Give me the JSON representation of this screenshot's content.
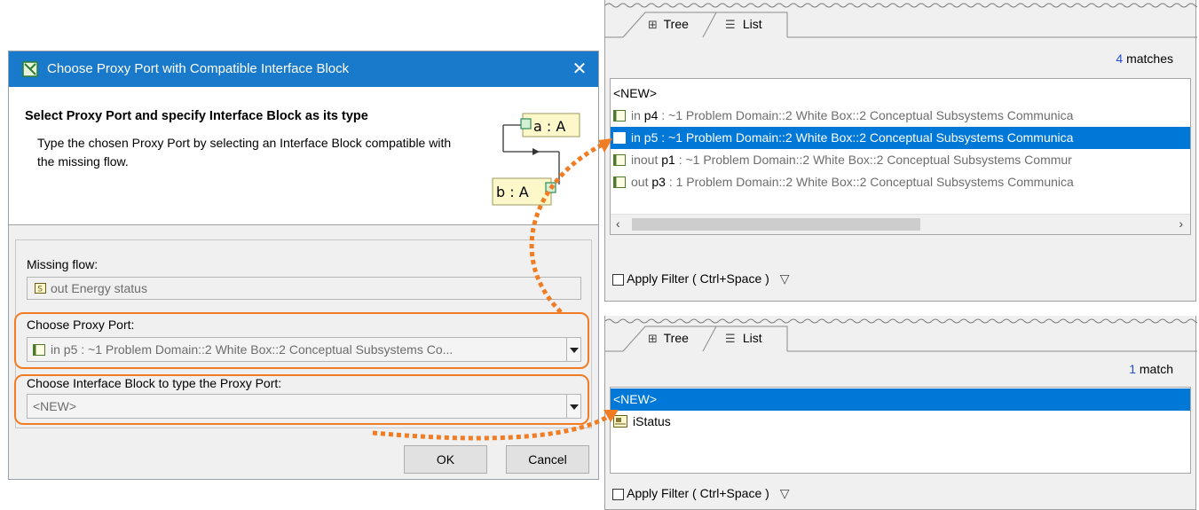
{
  "dialog": {
    "title": "Choose Proxy Port with Compatible Interface Block",
    "close_glyph": "✕",
    "header_title": "Select Proxy Port and specify Interface Block as its type",
    "header_desc": "Type the chosen Proxy Port by selecting an Interface Block compatible with the missing flow.",
    "diagram": {
      "top_label": "a : A",
      "bottom_label": "b : A"
    },
    "missing_flow_label": "Missing flow:",
    "missing_flow_value": "out Energy status",
    "proxy_port_label": "Choose Proxy Port:",
    "proxy_port_value": "in p5 : ~1 Problem Domain::2 White Box::2 Conceptual Subsystems Co...",
    "interface_block_label": "Choose Interface Block to type the Proxy Port:",
    "interface_block_value": "<NEW>",
    "ok_label": "OK",
    "cancel_label": "Cancel"
  },
  "top_panel": {
    "tab_tree": "Tree",
    "tab_list": "List",
    "matches_count": "4",
    "matches_word": " matches",
    "items": [
      {
        "pre": "",
        "name": "<NEW>",
        "rest": "",
        "icon": false,
        "selected": false
      },
      {
        "pre": "in ",
        "name": "p4",
        "rest": " : ~1 Problem Domain::2 White Box::2 Conceptual Subsystems Communica",
        "icon": true,
        "selected": false
      },
      {
        "pre": "in ",
        "name": "p5",
        "rest": " : ~1 Problem Domain::2 White Box::2 Conceptual Subsystems Communica",
        "icon": true,
        "selected": true
      },
      {
        "pre": "inout ",
        "name": "p1",
        "rest": " : ~1 Problem Domain::2 White Box::2 Conceptual Subsystems Commur",
        "icon": true,
        "selected": false
      },
      {
        "pre": "out ",
        "name": "p3",
        "rest": " : 1 Problem Domain::2 White Box::2 Conceptual Subsystems Communica",
        "icon": true,
        "selected": false
      }
    ],
    "filter_label": "Apply Filter ( Ctrl+Space )"
  },
  "bottom_panel": {
    "tab_tree": "Tree",
    "tab_list": "List",
    "matches_count": "1",
    "matches_word": " match",
    "items": [
      {
        "name": "<NEW>",
        "selected": true,
        "icon": false
      },
      {
        "name": "iStatus",
        "selected": false,
        "icon": true
      }
    ],
    "filter_label": "Apply Filter ( Ctrl+Space )"
  },
  "colors": {
    "titlebar": "#1979ca",
    "selection": "#0078d7",
    "highlight": "#f07d24",
    "matches_number": "#1f4fd1"
  }
}
